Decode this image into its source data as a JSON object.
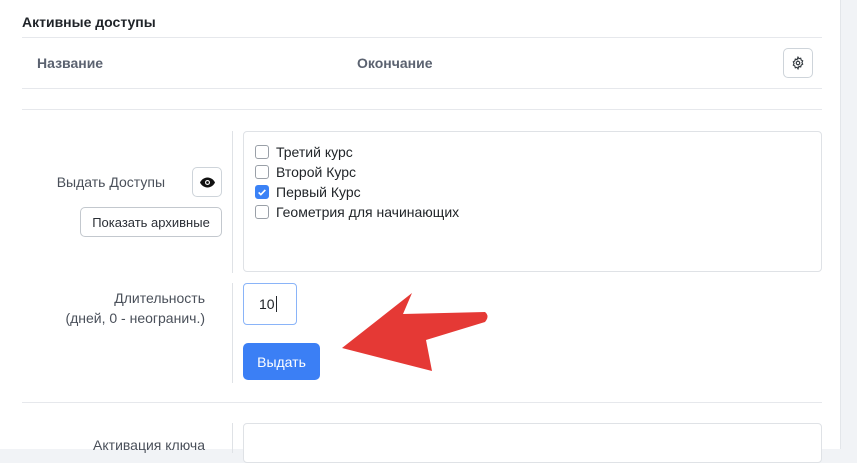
{
  "active_access": {
    "title": "Активные доступы",
    "columns": [
      "Название",
      "Окончание"
    ],
    "settings_icon": "gear-icon"
  },
  "grant_form": {
    "grant_label": "Выдать Доступы",
    "view_icon": "eye-icon",
    "show_archived_label": "Показать архивные",
    "courses": [
      {
        "label": "Третий курс",
        "checked": false
      },
      {
        "label": "Второй Курс",
        "checked": false
      },
      {
        "label": "Первый Курс",
        "checked": true
      },
      {
        "label": "Геометрия для начинающих",
        "checked": false
      }
    ],
    "duration_label": "Длительность",
    "duration_hint": "(дней, 0 - неогранич.)",
    "duration_value": "10",
    "issue_button": "Выдать"
  },
  "key_activation": {
    "label": "Активация ключа"
  },
  "colors": {
    "primary": "#3b7ff5",
    "annotation_arrow": "#e53935"
  }
}
